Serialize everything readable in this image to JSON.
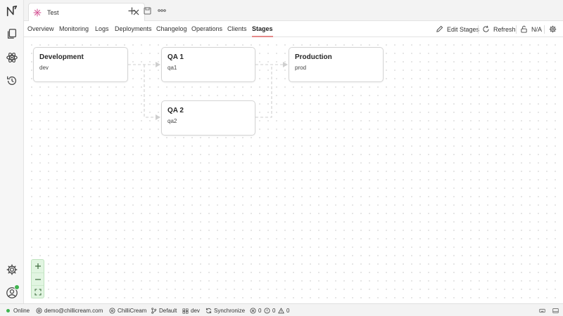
{
  "tab": {
    "title": "Test"
  },
  "nav": {
    "tabs": [
      "Overview",
      "Monitoring",
      "Logs",
      "Deployments",
      "Changelog",
      "Operations",
      "Clients",
      "Stages"
    ],
    "active": "Stages",
    "actions": {
      "edit_stages": "Edit Stages",
      "refresh": "Refresh",
      "lock_status": "N/A"
    }
  },
  "stages": [
    {
      "name": "Development",
      "key": "dev"
    },
    {
      "name": "QA 1",
      "key": "qa1"
    },
    {
      "name": "QA 2",
      "key": "qa2"
    },
    {
      "name": "Production",
      "key": "prod"
    }
  ],
  "status": {
    "connection": "Online",
    "user": "demo@chillicream.com",
    "workspace": "ChilliCream",
    "branch": "Default",
    "stage": "dev",
    "sync": "Synchronize",
    "errors": "0",
    "warnings": "0",
    "info": "0"
  },
  "icons": [
    "app-logo-icon",
    "documents-icon",
    "api-atom-icon",
    "history-icon",
    "settings-icon",
    "account-icon",
    "close-icon",
    "add-tab-icon",
    "save-icon",
    "more-icon",
    "pencil-icon",
    "refresh-icon",
    "unlock-icon",
    "gear-icon",
    "zoom-in-icon",
    "zoom-out-icon",
    "fit-view-icon",
    "workspace-icon",
    "branch-icon",
    "stage-icon",
    "sync-icon",
    "error-icon",
    "warning-icon",
    "info-icon",
    "keyboard-icon",
    "panel-icon"
  ],
  "colors": {
    "accent": "#e58a8a",
    "online": "#3fb34f",
    "zoom_bg": "#e1f5e1",
    "edge": "#cfcfcf"
  }
}
